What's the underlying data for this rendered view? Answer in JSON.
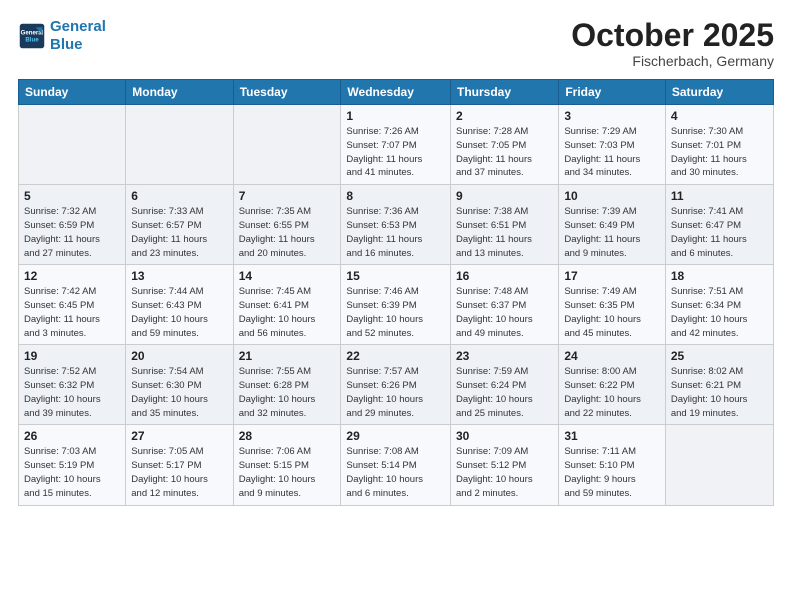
{
  "header": {
    "logo_line1": "General",
    "logo_line2": "Blue",
    "month": "October 2025",
    "location": "Fischerbach, Germany"
  },
  "weekdays": [
    "Sunday",
    "Monday",
    "Tuesday",
    "Wednesday",
    "Thursday",
    "Friday",
    "Saturday"
  ],
  "rows": [
    [
      {
        "num": "",
        "info": ""
      },
      {
        "num": "",
        "info": ""
      },
      {
        "num": "",
        "info": ""
      },
      {
        "num": "1",
        "info": "Sunrise: 7:26 AM\nSunset: 7:07 PM\nDaylight: 11 hours\nand 41 minutes."
      },
      {
        "num": "2",
        "info": "Sunrise: 7:28 AM\nSunset: 7:05 PM\nDaylight: 11 hours\nand 37 minutes."
      },
      {
        "num": "3",
        "info": "Sunrise: 7:29 AM\nSunset: 7:03 PM\nDaylight: 11 hours\nand 34 minutes."
      },
      {
        "num": "4",
        "info": "Sunrise: 7:30 AM\nSunset: 7:01 PM\nDaylight: 11 hours\nand 30 minutes."
      }
    ],
    [
      {
        "num": "5",
        "info": "Sunrise: 7:32 AM\nSunset: 6:59 PM\nDaylight: 11 hours\nand 27 minutes."
      },
      {
        "num": "6",
        "info": "Sunrise: 7:33 AM\nSunset: 6:57 PM\nDaylight: 11 hours\nand 23 minutes."
      },
      {
        "num": "7",
        "info": "Sunrise: 7:35 AM\nSunset: 6:55 PM\nDaylight: 11 hours\nand 20 minutes."
      },
      {
        "num": "8",
        "info": "Sunrise: 7:36 AM\nSunset: 6:53 PM\nDaylight: 11 hours\nand 16 minutes."
      },
      {
        "num": "9",
        "info": "Sunrise: 7:38 AM\nSunset: 6:51 PM\nDaylight: 11 hours\nand 13 minutes."
      },
      {
        "num": "10",
        "info": "Sunrise: 7:39 AM\nSunset: 6:49 PM\nDaylight: 11 hours\nand 9 minutes."
      },
      {
        "num": "11",
        "info": "Sunrise: 7:41 AM\nSunset: 6:47 PM\nDaylight: 11 hours\nand 6 minutes."
      }
    ],
    [
      {
        "num": "12",
        "info": "Sunrise: 7:42 AM\nSunset: 6:45 PM\nDaylight: 11 hours\nand 3 minutes."
      },
      {
        "num": "13",
        "info": "Sunrise: 7:44 AM\nSunset: 6:43 PM\nDaylight: 10 hours\nand 59 minutes."
      },
      {
        "num": "14",
        "info": "Sunrise: 7:45 AM\nSunset: 6:41 PM\nDaylight: 10 hours\nand 56 minutes."
      },
      {
        "num": "15",
        "info": "Sunrise: 7:46 AM\nSunset: 6:39 PM\nDaylight: 10 hours\nand 52 minutes."
      },
      {
        "num": "16",
        "info": "Sunrise: 7:48 AM\nSunset: 6:37 PM\nDaylight: 10 hours\nand 49 minutes."
      },
      {
        "num": "17",
        "info": "Sunrise: 7:49 AM\nSunset: 6:35 PM\nDaylight: 10 hours\nand 45 minutes."
      },
      {
        "num": "18",
        "info": "Sunrise: 7:51 AM\nSunset: 6:34 PM\nDaylight: 10 hours\nand 42 minutes."
      }
    ],
    [
      {
        "num": "19",
        "info": "Sunrise: 7:52 AM\nSunset: 6:32 PM\nDaylight: 10 hours\nand 39 minutes."
      },
      {
        "num": "20",
        "info": "Sunrise: 7:54 AM\nSunset: 6:30 PM\nDaylight: 10 hours\nand 35 minutes."
      },
      {
        "num": "21",
        "info": "Sunrise: 7:55 AM\nSunset: 6:28 PM\nDaylight: 10 hours\nand 32 minutes."
      },
      {
        "num": "22",
        "info": "Sunrise: 7:57 AM\nSunset: 6:26 PM\nDaylight: 10 hours\nand 29 minutes."
      },
      {
        "num": "23",
        "info": "Sunrise: 7:59 AM\nSunset: 6:24 PM\nDaylight: 10 hours\nand 25 minutes."
      },
      {
        "num": "24",
        "info": "Sunrise: 8:00 AM\nSunset: 6:22 PM\nDaylight: 10 hours\nand 22 minutes."
      },
      {
        "num": "25",
        "info": "Sunrise: 8:02 AM\nSunset: 6:21 PM\nDaylight: 10 hours\nand 19 minutes."
      }
    ],
    [
      {
        "num": "26",
        "info": "Sunrise: 7:03 AM\nSunset: 5:19 PM\nDaylight: 10 hours\nand 15 minutes."
      },
      {
        "num": "27",
        "info": "Sunrise: 7:05 AM\nSunset: 5:17 PM\nDaylight: 10 hours\nand 12 minutes."
      },
      {
        "num": "28",
        "info": "Sunrise: 7:06 AM\nSunset: 5:15 PM\nDaylight: 10 hours\nand 9 minutes."
      },
      {
        "num": "29",
        "info": "Sunrise: 7:08 AM\nSunset: 5:14 PM\nDaylight: 10 hours\nand 6 minutes."
      },
      {
        "num": "30",
        "info": "Sunrise: 7:09 AM\nSunset: 5:12 PM\nDaylight: 10 hours\nand 2 minutes."
      },
      {
        "num": "31",
        "info": "Sunrise: 7:11 AM\nSunset: 5:10 PM\nDaylight: 9 hours\nand 59 minutes."
      },
      {
        "num": "",
        "info": ""
      }
    ]
  ]
}
